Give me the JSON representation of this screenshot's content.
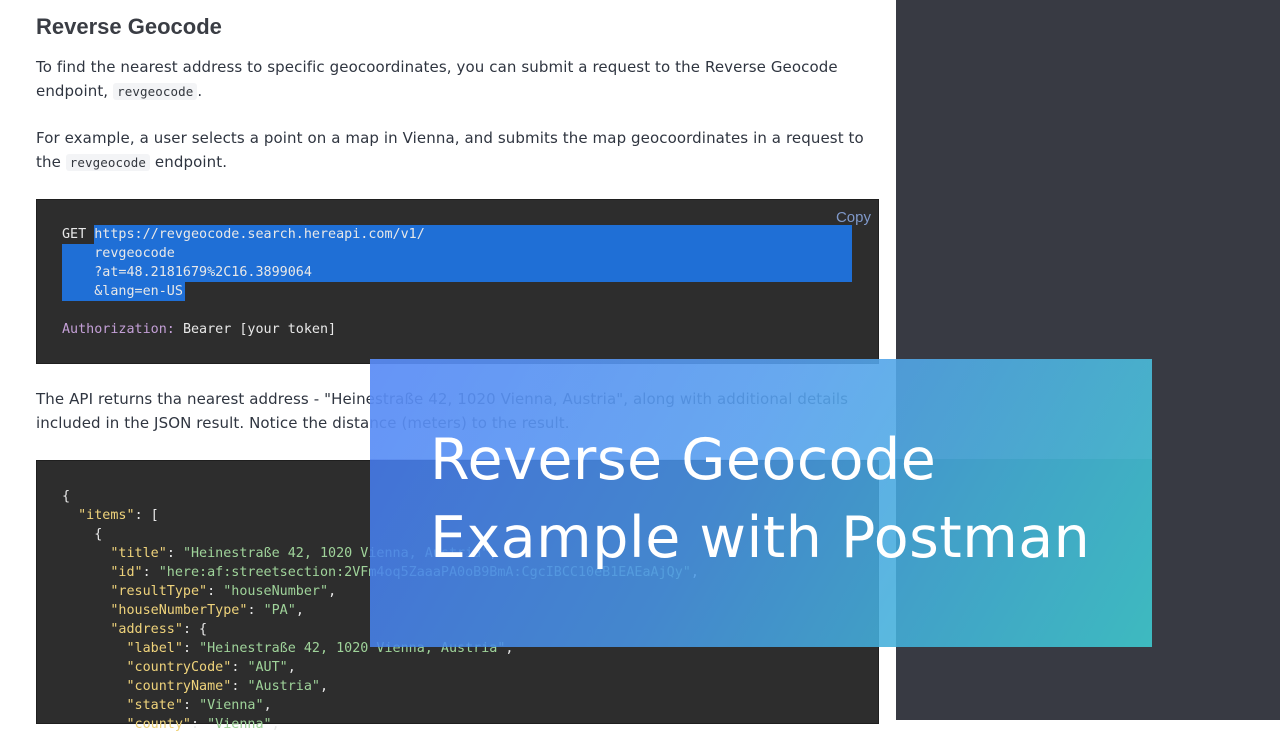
{
  "doc": {
    "heading": "Reverse Geocode",
    "para1": {
      "text_before": "To find the nearest address to specific geocoordinates, you can submit a request to the Reverse Geocode endpoint, ",
      "code": "revgeocode",
      "text_after": "."
    },
    "para2": {
      "text_before": "For example, a user selects a point on a map in Vienna, and submits the map geocoordinates in a request to the ",
      "code": "revgeocode",
      "text_after": " endpoint."
    },
    "request_block": {
      "copy_label": "Copy",
      "method": "GET",
      "url_lines": [
        "https://revgeocode.search.hereapi.com/v1/",
        "revgeocode",
        "?at=48.2181679%2C16.3899064",
        "&lang=en-US"
      ],
      "auth_key": "Authorization:",
      "auth_value": "Bearer [your token]"
    },
    "para3": {
      "line1": "The API returns tha nearest address - \"Heinestraße 42, 1020 Vienna, Austria\", along with additional details",
      "line2": "included in the JSON result. Notice the distance (meters) to the result."
    },
    "response_block": {
      "open_brace": "{",
      "items_key": "\"items\"",
      "items_open": ": [",
      "obj_open": "{",
      "title_key": "\"title\"",
      "title_val": "\"Heinestraße 42, 1020 Vienna, Austria\"",
      "id_key": "\"id\"",
      "id_val": "\"here:af:streetsection:2VFm4oq5ZaaaPA0oB9BmA:CgcIBCC10eB1EAEaAjQy\"",
      "resultType_key": "\"resultType\"",
      "resultType_val": "\"houseNumber\"",
      "houseNumberType_key": "\"houseNumberType\"",
      "houseNumberType_val": "\"PA\"",
      "address_key": "\"address\"",
      "address_open": ": {",
      "label_key": "\"label\"",
      "label_val": "\"Heinestraße 42, 1020 Vienna, Austria\"",
      "countryCode_key": "\"countryCode\"",
      "countryCode_val": "\"AUT\"",
      "countryName_key": "\"countryName\"",
      "countryName_val": "\"Austria\"",
      "state_key": "\"state\"",
      "state_val": "\"Vienna\"",
      "county_key": "\"county\"",
      "county_val": "\"Vienna\""
    }
  },
  "overlay": {
    "line1": "Reverse Geocode",
    "line2": "Example with Postman"
  },
  "colors": {
    "right_panel": "#383a43",
    "code_bg": "#2d2d2d",
    "selection": "#1f6fd6",
    "json_key": "#efd37b",
    "json_string": "#9fd39a",
    "auth_key": "#c39fd6"
  }
}
